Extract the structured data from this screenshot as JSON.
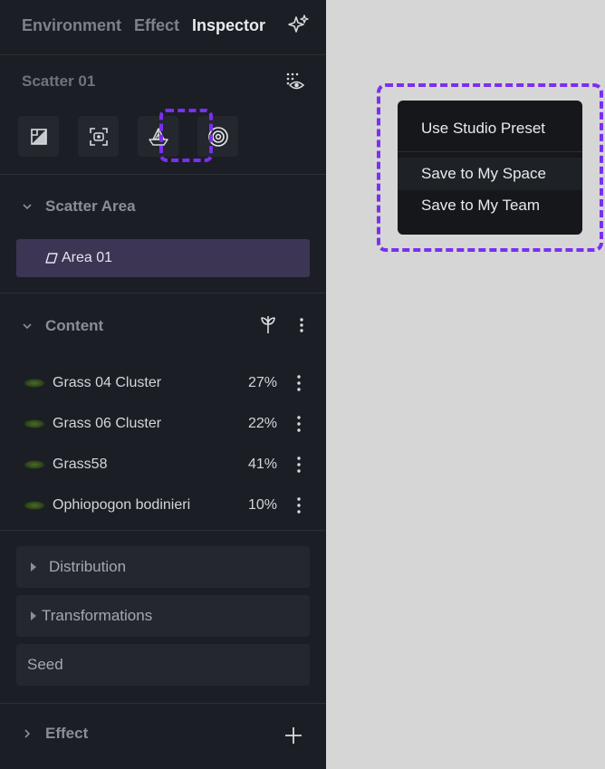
{
  "tabs": [
    "Environment",
    "Effect",
    "Inspector"
  ],
  "active_tab": "Inspector",
  "object_title": "Scatter 01",
  "tools": [
    "area-tool-icon",
    "focus-tool-icon",
    "boat-tool-icon",
    "target-tool-icon"
  ],
  "scatter_area": {
    "label": "Scatter Area",
    "item": "Area 01"
  },
  "content": {
    "label": "Content",
    "items": [
      {
        "name": "Grass 04 Cluster",
        "pct": "27%"
      },
      {
        "name": "Grass 06 Cluster",
        "pct": "22%"
      },
      {
        "name": "Grass58",
        "pct": "41%"
      },
      {
        "name": "Ophiopogon bodinieri",
        "pct": "10%"
      }
    ]
  },
  "sections": {
    "distribution": "Distribution",
    "transformations": "Transformations",
    "seed": "Seed"
  },
  "effect_label": "Effect",
  "menu": {
    "use_preset": "Use Studio Preset",
    "save_space": "Save to My Space",
    "save_team": "Save to My Team"
  },
  "colors": {
    "accent": "#7b2ff0",
    "panel_bg": "#1b1e24",
    "selected_row": "#3d3554",
    "canvas": "#d6d6d6"
  }
}
